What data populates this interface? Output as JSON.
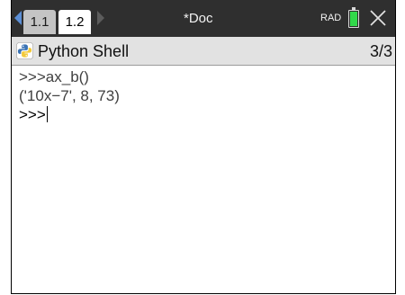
{
  "tabs": [
    {
      "label": "1.1"
    },
    {
      "label": "1.2"
    }
  ],
  "document_title": "*Doc",
  "angle_mode": "RAD",
  "app": {
    "title": "Python Shell",
    "page_counter": "3/3"
  },
  "shell": {
    "lines": [
      ">>>ax_b()",
      "('10x−7', 8, 73)",
      ">>>"
    ]
  },
  "icons": {
    "nav_left": "triangle-left-icon",
    "nav_right": "triangle-right-icon",
    "battery": "battery-icon",
    "close": "close-icon",
    "python": "python-logo-icon"
  },
  "colors": {
    "topbar": "#2f2f2f",
    "battery_fill": "#31d84a",
    "nav_arrow": "#5c8fd6",
    "app_bar": "#e2e2e2"
  }
}
